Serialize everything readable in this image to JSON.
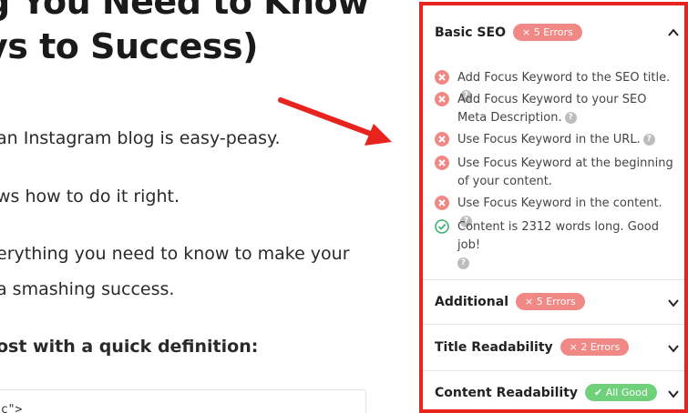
{
  "article": {
    "headline_line1": "g You Need to Know",
    "headline_line2": "ys to Success)",
    "paragraphs": [
      "an Instagram blog is easy-peasy.",
      "ws how to do it right.",
      "erything you need to know to make your",
      "a smashing success."
    ],
    "lead_in": "ost with a quick definition:",
    "code_snippet": "nc\">"
  },
  "panel": {
    "help_glyph": "?",
    "sections": [
      {
        "title": "Basic SEO",
        "badge": "× 5 Errors",
        "status": "error",
        "expanded": true
      },
      {
        "title": "Additional",
        "badge": "× 5 Errors",
        "status": "error",
        "expanded": false
      },
      {
        "title": "Title Readability",
        "badge": "× 2 Errors",
        "status": "error",
        "expanded": false
      },
      {
        "title": "Content Readability",
        "badge": "✔ All Good",
        "status": "good",
        "expanded": false
      }
    ],
    "checks": [
      {
        "text": "Add Focus Keyword to the SEO title.",
        "status": "error"
      },
      {
        "text": "Add Focus Keyword to your SEO Meta Description.",
        "status": "error"
      },
      {
        "text": "Use Focus Keyword in the URL.",
        "status": "error"
      },
      {
        "text": "Use Focus Keyword at the beginning of your content.",
        "status": "error"
      },
      {
        "text": "Use Focus Keyword in the content.",
        "status": "error"
      },
      {
        "text": "Content is 2312 words long. Good job!",
        "status": "good"
      }
    ]
  },
  "colors": {
    "highlight_border": "#e8231e",
    "error": "#f08985",
    "good": "#6fd17a",
    "arrow": "#e8231e"
  },
  "icons": {
    "error": "x-circle-icon",
    "good": "check-circle-icon",
    "help": "question-mark-icon",
    "chevron_up": "chevron-up-icon",
    "chevron_down": "chevron-down-icon"
  }
}
